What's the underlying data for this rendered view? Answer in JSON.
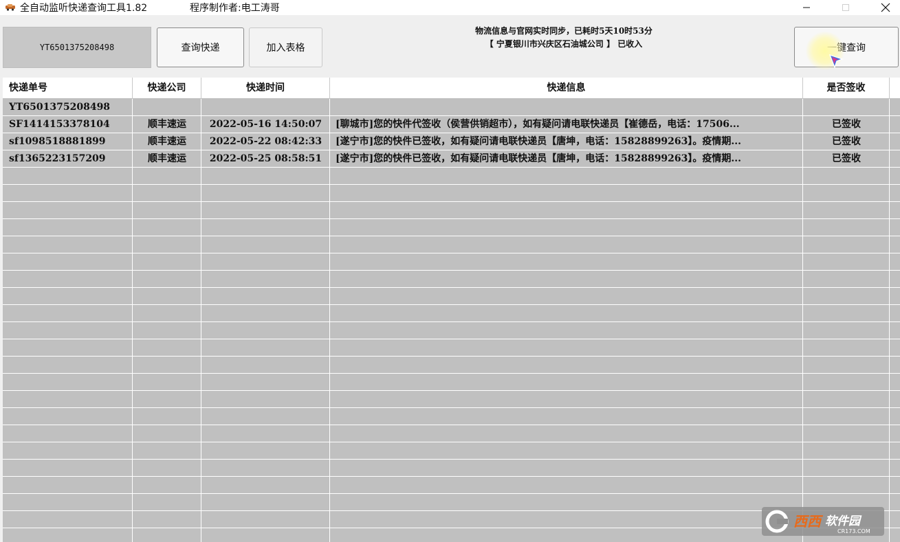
{
  "window": {
    "title": "全自动监听快递查询工具1.82",
    "author": "程序制作者:电工涛哥"
  },
  "toolbar": {
    "tracking_input_value": "YT6501375208498",
    "query_button": "查询快递",
    "add_button": "加入表格",
    "status_line1": "物流信息与官网实时同步，已耗时5天10时53分",
    "status_line2": "【 宁夏银川市兴庆区石油城公司 】 已收入",
    "one_click_button": "一键查询"
  },
  "table": {
    "columns": [
      "快递单号",
      "快递公司",
      "快递时间",
      "快递信息",
      "是否签收"
    ],
    "rows": [
      [
        "YT6501375208498",
        "",
        "",
        "",
        ""
      ],
      [
        "SF1414153378104",
        "顺丰速运",
        "2022-05-16 14:50:07",
        "[聊城市]您的快件代签收（侯营供销超市），如有疑问请电联快递员【崔德岳，电话：17506...",
        "已签收"
      ],
      [
        "sf1098518881899",
        "顺丰速运",
        "2022-05-22 08:42:33",
        "[遂宁市]您的快件已签收，如有疑问请电联快递员【唐坤，电话：15828899263】。疫情期...",
        "已签收"
      ],
      [
        "sf1365223157209",
        "顺丰速运",
        "2022-05-25 08:58:51",
        "[遂宁市]您的快件已签收，如有疑问请电联快递员【唐坤，电话：15828899263】。疫情期...",
        "已签收"
      ]
    ],
    "empty_row_count": 22
  },
  "icons": {
    "app": "car-icon",
    "minimize": "minimize-icon",
    "maximize": "maximize-icon",
    "close": "close-icon",
    "cursor": "mouse-pointer-icon"
  },
  "watermark": {
    "text": "西西软件园",
    "sub": "CR173.COM"
  }
}
